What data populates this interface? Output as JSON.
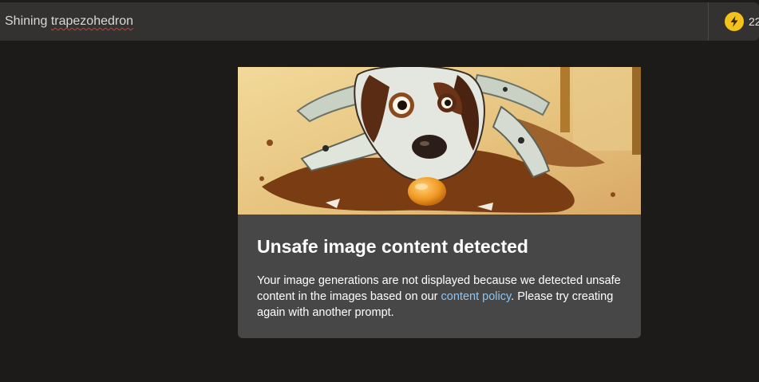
{
  "prompt": {
    "text_before": "Shining ",
    "text_misspelled": "trapezohedron"
  },
  "credits": {
    "icon": "lightning-bolt-icon",
    "count": "22"
  },
  "warning_card": {
    "title": "Unsafe image content detected",
    "body_before_link": "Your image generations are not displayed because we detected unsafe content in the images based on our ",
    "link_text": "content policy",
    "body_after_link": ". Please try creating again with another prompt."
  },
  "colors": {
    "background": "#1c1b1a",
    "top_bar": "#343231",
    "card": "#474747",
    "link": "#8ec6f2",
    "credit_icon": "#f3c21b"
  }
}
